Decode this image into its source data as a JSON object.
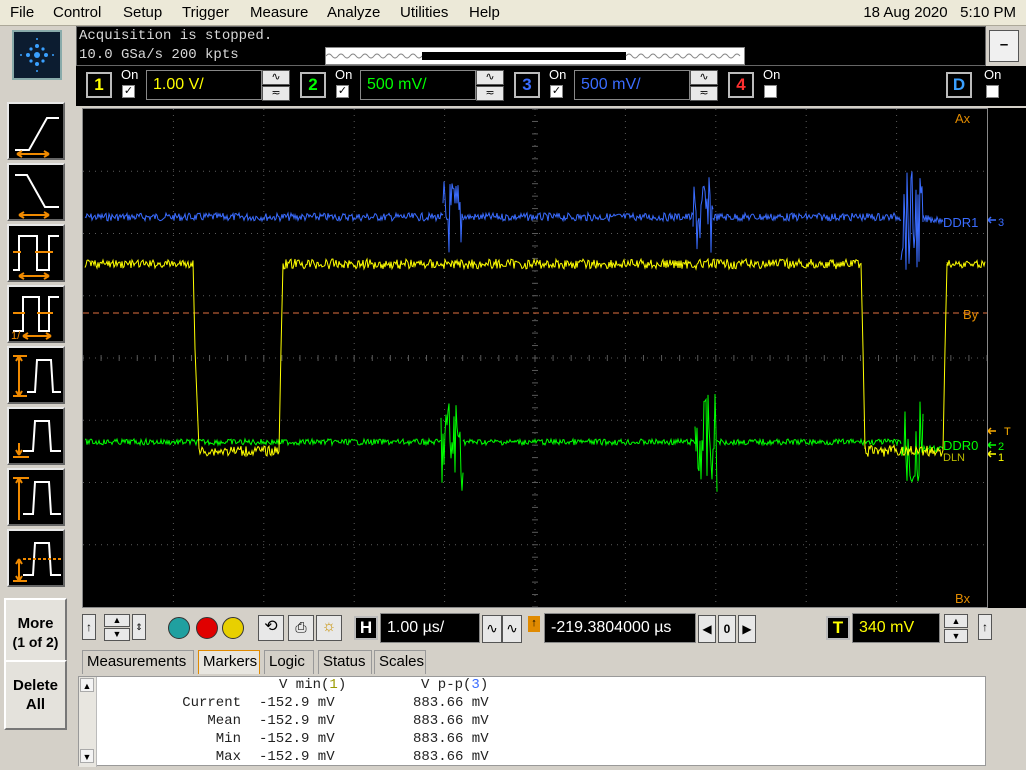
{
  "menu": {
    "file": "File",
    "control": "Control",
    "setup": "Setup",
    "trigger": "Trigger",
    "measure": "Measure",
    "analyze": "Analyze",
    "utilities": "Utilities",
    "help": "Help",
    "date": "18 Aug 2020",
    "time": "5:10 PM"
  },
  "status": {
    "line1": "Acquisition is stopped.",
    "line2": "10.0 GSa/s   200 kpts"
  },
  "minimize": "–",
  "channels": {
    "ch1": {
      "num": "1",
      "on_label": "On",
      "on": "✓",
      "scale": "1.00 V/",
      "color": "#ffff00"
    },
    "ch2": {
      "num": "2",
      "on_label": "On",
      "on": "✓",
      "scale": "500 mV/",
      "color": "#00ff00"
    },
    "ch3": {
      "num": "3",
      "on_label": "On",
      "on": "✓",
      "scale": "500 mV/",
      "color": "#3a6cff"
    },
    "ch4": {
      "num": "4",
      "on_label": "On",
      "on": "",
      "color": "#ff3030"
    },
    "d": {
      "num": "D",
      "on_label": "On",
      "on": ""
    }
  },
  "coupling": {
    "ac": "∿",
    "dc": "≂"
  },
  "screen": {
    "marker_ax": "Ax",
    "marker_by": "By",
    "marker_bx": "Bx",
    "label_ddr1": "DDR1",
    "label_ddr0": "DDR0",
    "label_dln": "DLN",
    "ch_mark_3": "3",
    "ch_mark_2": "2",
    "ch_mark_1": "1",
    "trig_mark": "T"
  },
  "controls": {
    "h_button": "H",
    "timebase": "1.00 µs/",
    "delay": "-219.3804000 µs",
    "zero": "0",
    "t_button": "T",
    "trigger_level": "340 mV"
  },
  "left": {
    "more_label": "More",
    "more_sub": "(1 of 2)",
    "delete_label": "Delete",
    "delete_sub": "All"
  },
  "tabs": [
    "Measurements",
    "Markers",
    "Logic",
    "Status",
    "Scales"
  ],
  "active_tab": "Markers",
  "measurements": {
    "col1_header": "V min(",
    "col1_ch": "1",
    "col2_header": "V p-p(",
    "col2_ch": "3",
    "close": ")",
    "rows": [
      {
        "label": "Current",
        "v1": "-152.9 mV",
        "v2": "883.66 mV"
      },
      {
        "label": "Mean",
        "v1": "-152.9 mV",
        "v2": "883.66 mV"
      },
      {
        "label": "Min",
        "v1": "-152.9 mV",
        "v2": "883.66 mV"
      },
      {
        "label": "Max",
        "v1": "-152.9 mV",
        "v2": "883.66 mV"
      }
    ]
  },
  "colors": {
    "ch1": "#ffff00",
    "ch2": "#00ff00",
    "ch3": "#3a6cff",
    "ch4": "#ff3030",
    "marker": "#e08a00",
    "grid": "#5a5a5a"
  }
}
